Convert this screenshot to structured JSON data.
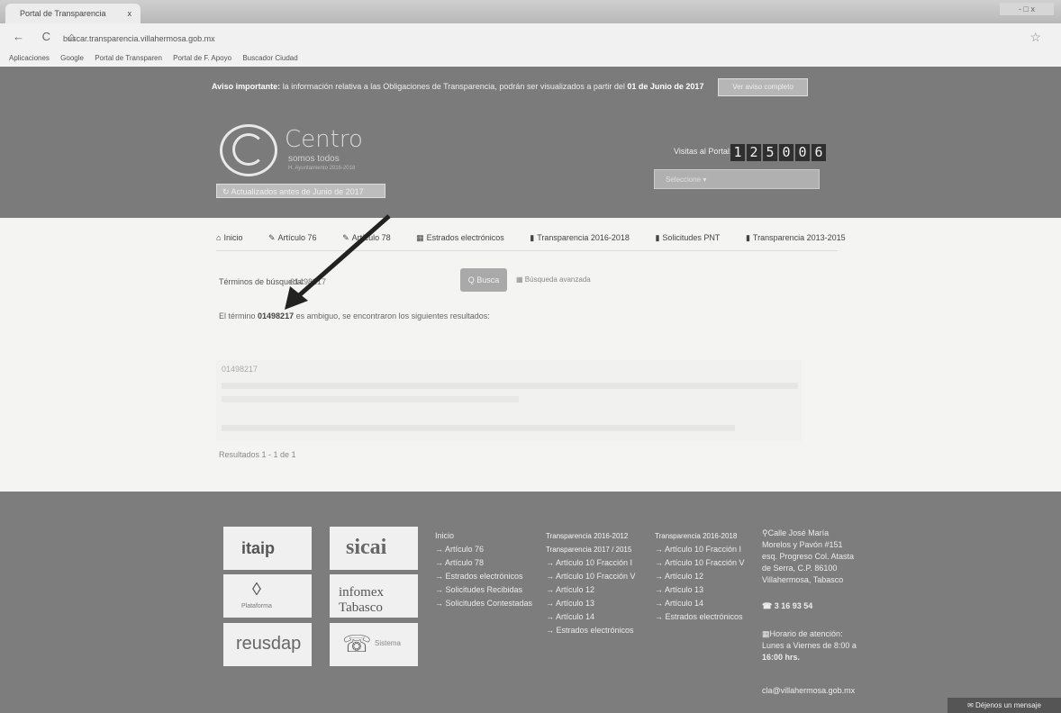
{
  "browser": {
    "tab_title": "Portal de Transparencia",
    "tab_close": "x",
    "window_controls": "- □ x",
    "nav_buttons": "← C ⌂",
    "url": "buscar.transparencia.villahermosa.gob.mx",
    "bookmarks": [
      "Aplicaciones",
      "Google",
      "Portal de Transparen",
      "Portal de F. Apoyo",
      "Buscador Ciudad"
    ]
  },
  "header": {
    "notice_bold": "Aviso importante:",
    "notice_text": " la información relativa a las Obligaciones de Transparencia, podrán ser visualizados a partir del",
    "notice_date": "01 de Junio de 2017",
    "notice_button": "Ver aviso completo",
    "logo_title": "Centro",
    "logo_subtitle": "somos todos",
    "logo_small": "H. Ayuntamiento 2016-2018",
    "update_button": "Actualizados antes de Junio de 2017",
    "visits_label": "Visitas al Portal:",
    "visits_digits": [
      "1",
      "2",
      "5",
      "0",
      "0",
      "6"
    ],
    "search_select_placeholder": "Seleccione"
  },
  "nav": [
    {
      "icon": "home-icon",
      "glyph": "⌂",
      "label": "Inicio"
    },
    {
      "icon": "book-icon",
      "glyph": "✎",
      "label": "Artículo 76"
    },
    {
      "icon": "book-icon",
      "glyph": "✎",
      "label": "Artículo 78"
    },
    {
      "icon": "list-icon",
      "glyph": "▦",
      "label": "Estrados electrónicos"
    },
    {
      "icon": "book-icon",
      "glyph": "▮",
      "label": "Transparencia 2016-2018"
    },
    {
      "icon": "book-icon",
      "glyph": "▮",
      "label": "Solicitudes PNT"
    },
    {
      "icon": "book-icon",
      "glyph": "▮",
      "label": "Transparencia 2013-2015"
    }
  ],
  "search": {
    "terms_label": "Términos de búsqueda:",
    "terms_value": "01498217",
    "button_label": "Q Busca",
    "advanced_link": "Búsqueda avanzada",
    "result_prefix": "El término",
    "result_term": "01498217",
    "result_suffix": "es ambiguo, se encontraron los siguientes resultados:",
    "result_title": "01498217",
    "results_count": "Resultados 1 - 1 de 1"
  },
  "footer": {
    "badges": [
      "itaip",
      "sicai",
      "Plataforma",
      "infomex Tabasco",
      "reusdap",
      "Sistema"
    ],
    "col1": [
      "Inicio",
      "→ Artículo 76",
      "→ Artículo 78",
      "→ Estrados electrónicos",
      "→ Solicitudes Recibidas",
      "→ Solicitudes Contestadas"
    ],
    "col2_head1": "Transparencia 2016-2012",
    "col2_head2": "Transparencia 2017 / 2015",
    "col2": [
      "→ Artículo 10 Fracción I",
      "→ Artículo 10 Fracción V",
      "→ Artículo 12",
      "→ Artículo 13",
      "→ Artículo 14",
      "→ Estrados electrónicos"
    ],
    "col3_head": "Transparencia 2016-2018",
    "col3": [
      "→ Artículo 10 Fracción I",
      "→ Artículo 10 Fracción V",
      "→ Artículo 12",
      "→ Artículo 13",
      "→ Artículo 14",
      "→ Estrados electrónicos"
    ],
    "address": [
      "Calle José María",
      "Morelos y Pavón #151",
      "esq. Progreso Col. Atasta",
      "de Serra, C.P. 86100",
      "Villahermosa, Tabasco"
    ],
    "phone": "3 16 93 54",
    "hours": [
      "Horario de atención:",
      "Lunes a Viernes de 8:00 a",
      "16:00 hrs."
    ],
    "email": "cla@villahermosa.gob.mx",
    "contact_button": "Déjenos un mensaje"
  }
}
